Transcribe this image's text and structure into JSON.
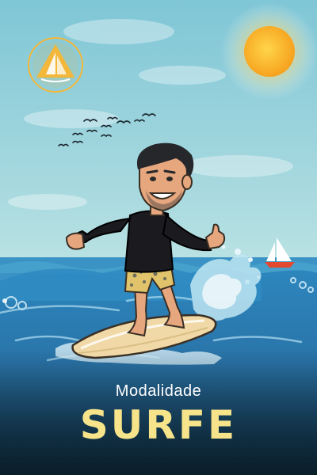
{
  "caption": {
    "subtitle": "Modalidade",
    "title": "SURFE"
  },
  "colors": {
    "title": "#f6e38a",
    "subtitle": "#ffffff",
    "sky": "#a8d9df",
    "sea": "#2b76ad",
    "sun": "#fcc93a",
    "logo": "#f3b73a"
  },
  "icons": {
    "logo": "sailboat-triangle-logo",
    "sun": "sun-icon",
    "boat": "sailboat-icon",
    "birds": "birds-flock"
  }
}
